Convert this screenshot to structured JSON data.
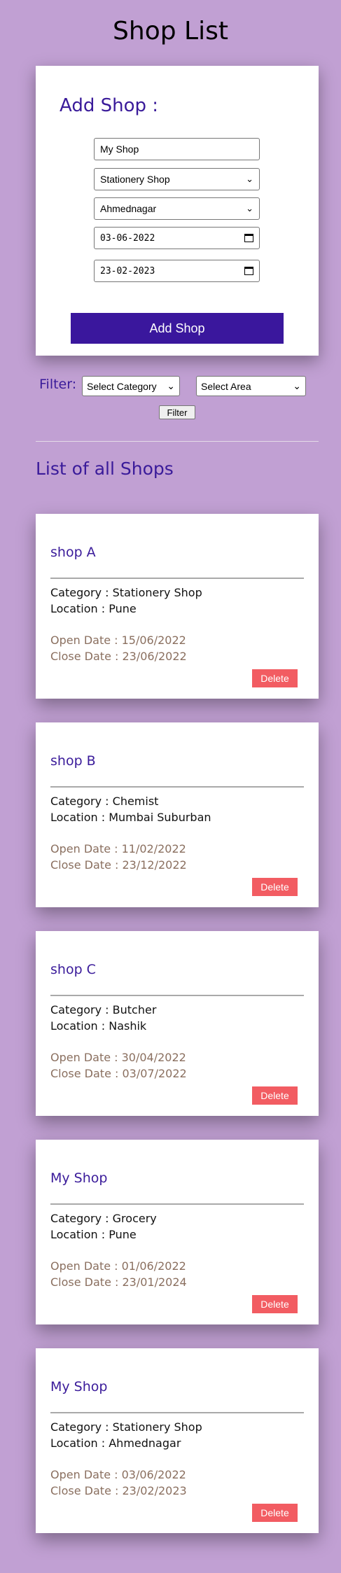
{
  "page": {
    "title": "Shop List"
  },
  "form": {
    "title": "Add Shop :",
    "name_value": "My Shop",
    "category_value": "Stationery Shop",
    "area_value": "Ahmednagar",
    "open_date_value": "03-06-2022",
    "close_date_value": "23-02-2023",
    "submit_label": "Add Shop"
  },
  "filter": {
    "label": "Filter:",
    "category_placeholder": "Select Category",
    "area_placeholder": "Select Area",
    "button_label": "Filter"
  },
  "list": {
    "title": "List of all Shops",
    "shops": [
      {
        "name": "shop A",
        "category": "Category : Stationery Shop",
        "location": "Location : Pune",
        "open": "Open Date : 15/06/2022",
        "close": "Close Date : 23/06/2022",
        "delete_label": "Delete"
      },
      {
        "name": "shop B",
        "category": "Category : Chemist",
        "location": "Location : Mumbai Suburban",
        "open": "Open Date : 11/02/2022",
        "close": "Close Date : 23/12/2022",
        "delete_label": "Delete"
      },
      {
        "name": "shop C",
        "category": "Category : Butcher",
        "location": "Location : Nashik",
        "open": "Open Date : 30/04/2022",
        "close": "Close Date : 03/07/2022",
        "delete_label": "Delete"
      },
      {
        "name": "My Shop",
        "category": "Category : Grocery",
        "location": "Location : Pune",
        "open": "Open Date : 01/06/2022",
        "close": "Close Date : 23/01/2024",
        "delete_label": "Delete"
      },
      {
        "name": "My Shop",
        "category": "Category : Stationery Shop",
        "location": "Location : Ahmednagar",
        "open": "Open Date : 03/06/2022",
        "close": "Close Date : 23/02/2023",
        "delete_label": "Delete"
      }
    ]
  },
  "colors": {
    "background": "#c1a0d3",
    "accent": "#3a179d",
    "delete": "#f25c62",
    "date_text": "#8a6f5f"
  }
}
